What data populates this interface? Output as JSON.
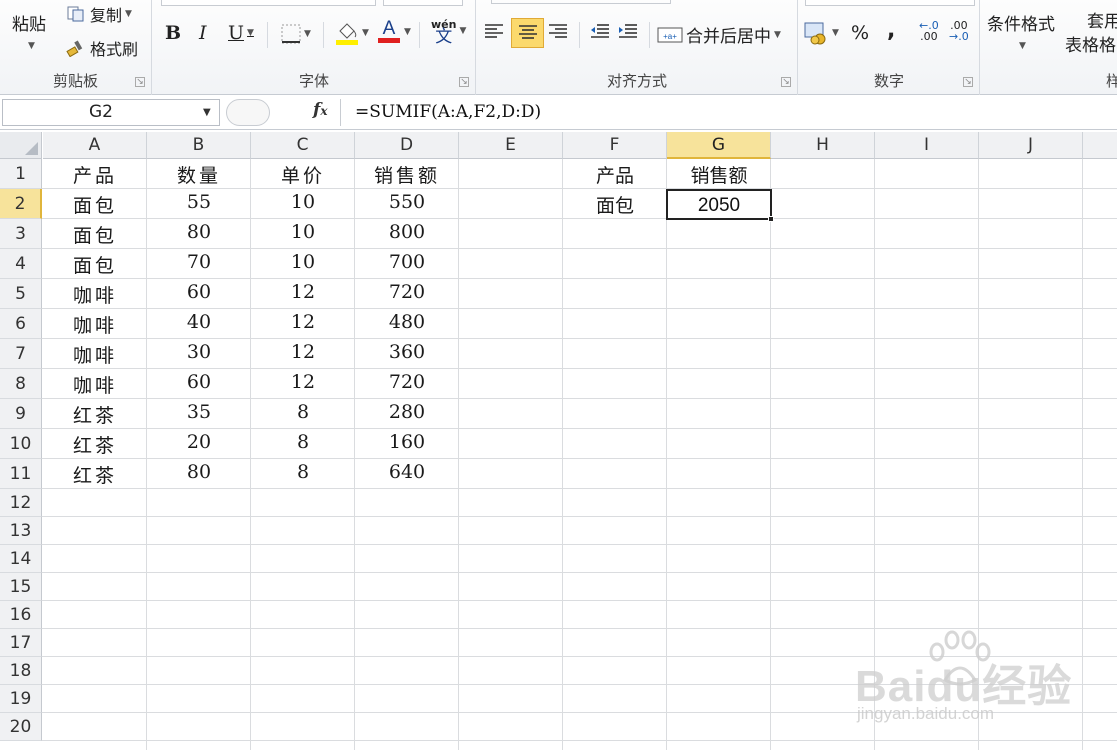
{
  "ribbon": {
    "clipboard": {
      "paste": "粘贴",
      "copy": "复制",
      "format_painter": "格式刷",
      "label": "剪贴板"
    },
    "font": {
      "bold": "B",
      "italic": "I",
      "underline": "U",
      "font_color_glyph": "A",
      "phonetic_top": "wén",
      "phonetic_bottom": "文",
      "label": "字体",
      "fill_color": "#ffef00",
      "text_color": "#e02020"
    },
    "alignment": {
      "merge_center": "合并后居中",
      "label": "对齐方式"
    },
    "number": {
      "percent": "%",
      "comma": ",",
      "inc_decimal": ".00",
      "dec_decimal": ".00",
      "label": "数字"
    },
    "styles": {
      "conditional_format": "条件格式",
      "table_format_top": "套用",
      "table_format_bottom": "表格格",
      "label": "样"
    }
  },
  "formula_bar": {
    "name_box": "G2",
    "fx": "fx",
    "formula": "=SUMIF(A:A,F2,D:D)"
  },
  "sheet": {
    "columns": [
      "A",
      "B",
      "C",
      "D",
      "E",
      "F",
      "G",
      "H",
      "I",
      "J"
    ],
    "rows": [
      "1",
      "2",
      "3",
      "4",
      "5",
      "6",
      "7",
      "8",
      "9",
      "10",
      "11",
      "12",
      "13",
      "14",
      "15",
      "16",
      "17",
      "18",
      "19",
      "20"
    ],
    "headers": [
      "产品",
      "数量",
      "单价",
      "销售额"
    ],
    "data": [
      [
        "面包",
        "55",
        "10",
        "550"
      ],
      [
        "面包",
        "80",
        "10",
        "800"
      ],
      [
        "面包",
        "70",
        "10",
        "700"
      ],
      [
        "咖啡",
        "60",
        "12",
        "720"
      ],
      [
        "咖啡",
        "40",
        "12",
        "480"
      ],
      [
        "咖啡",
        "30",
        "12",
        "360"
      ],
      [
        "咖啡",
        "60",
        "12",
        "720"
      ],
      [
        "红茶",
        "35",
        "8",
        "280"
      ],
      [
        "红茶",
        "20",
        "8",
        "160"
      ],
      [
        "红茶",
        "80",
        "8",
        "640"
      ]
    ],
    "lookup": {
      "f1": "产品",
      "g1": "销售额",
      "f2": "面包",
      "g2": "2050"
    },
    "selected_column": "G",
    "selected_row": "2",
    "accent": "#f7e39b"
  },
  "watermark": {
    "brand": "Baidu经验",
    "url": "jingyan.baidu.com"
  }
}
